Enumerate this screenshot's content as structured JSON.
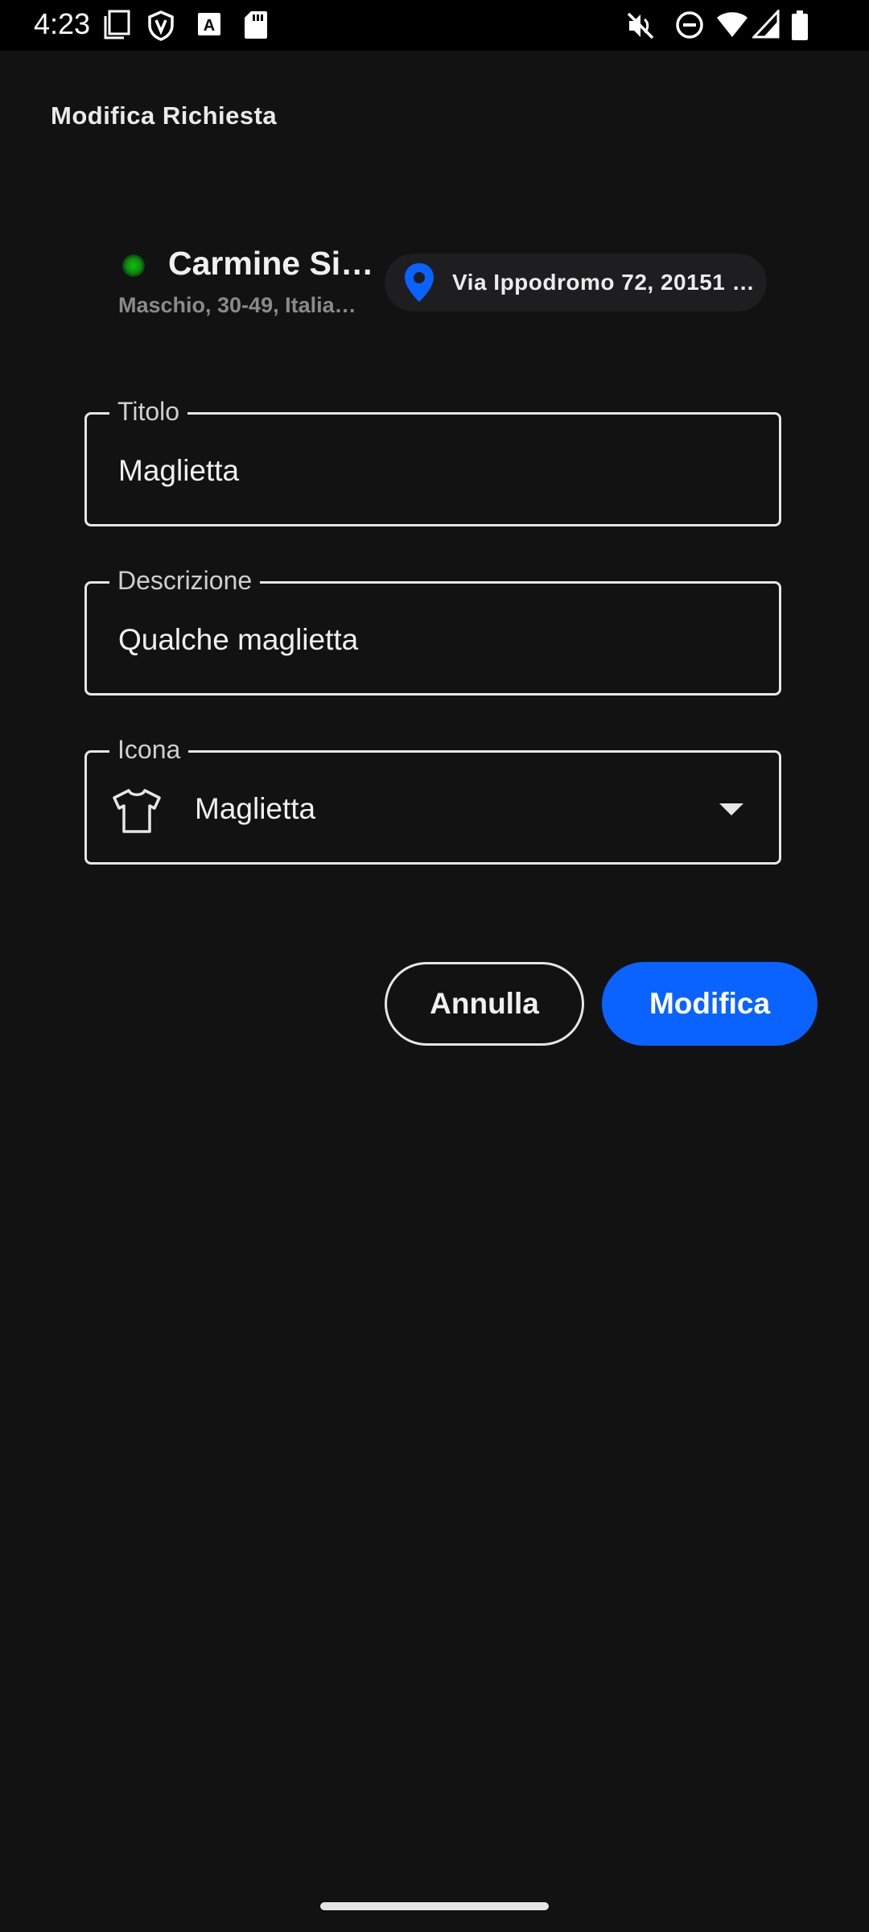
{
  "status_bar": {
    "time": "4:23",
    "icons": [
      "notification-card-icon",
      "shield-icon",
      "text-a-icon",
      "sd-card-icon",
      "mute-icon",
      "do-not-disturb-icon",
      "wifi-icon",
      "signal-icon",
      "battery-icon"
    ]
  },
  "header": {
    "title": "Modifica Richiesta"
  },
  "user": {
    "status_color": "#12b012",
    "name": "Carmine Siri…",
    "meta": "Maschio, 30-49,  Italia…",
    "address": "Via Ippodromo 72, 20151 …",
    "pin_color": "#0a63ff"
  },
  "form": {
    "title": {
      "label": "Titolo",
      "value": "Maglietta"
    },
    "description": {
      "label": "Descrizione",
      "value": "Qualche maglietta"
    },
    "icon": {
      "label": "Icona",
      "value": "Maglietta",
      "icon": "tshirt-icon"
    }
  },
  "actions": {
    "cancel_label": "Annulla",
    "submit_label": "Modifica",
    "accent_color": "#0a63ff"
  }
}
